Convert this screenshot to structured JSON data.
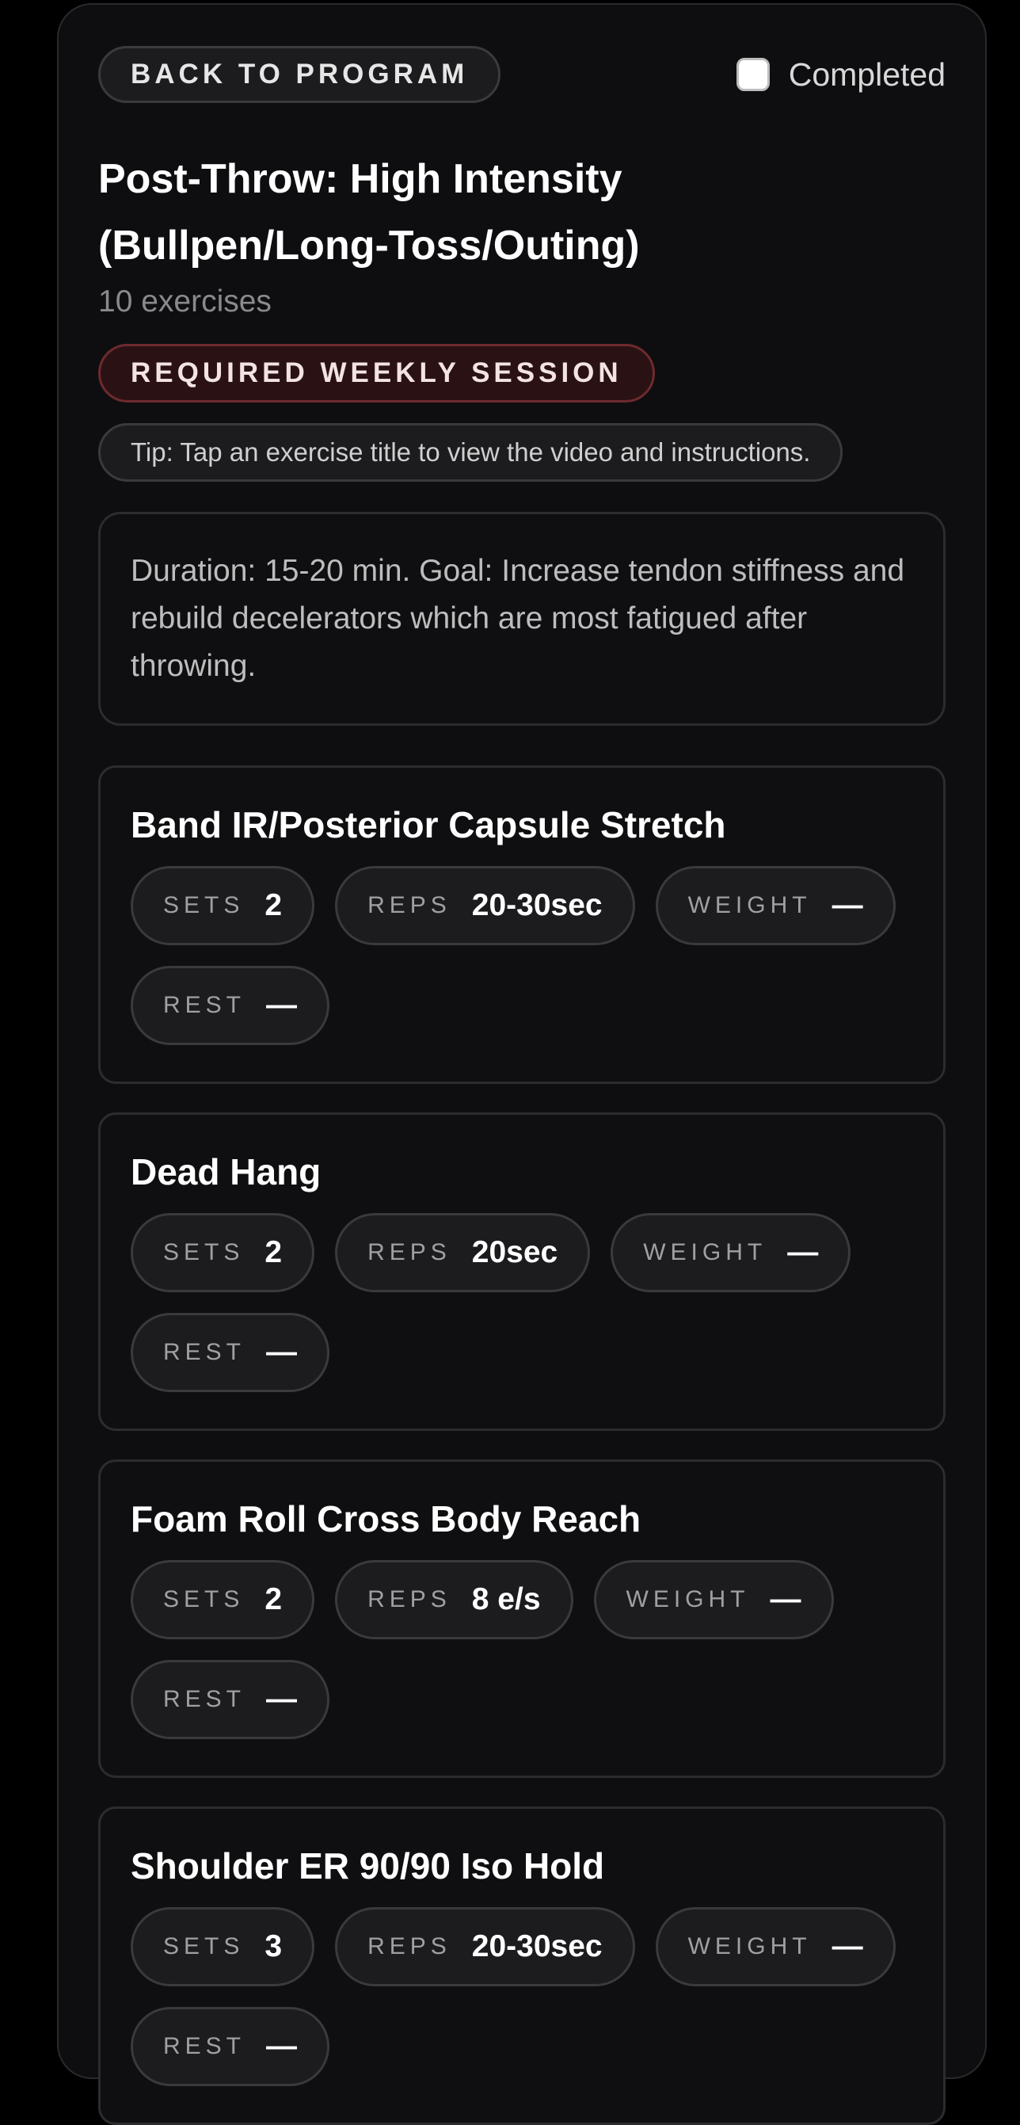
{
  "header": {
    "back_label": "BACK TO PROGRAM",
    "completed_label": "Completed",
    "completed_checked": false
  },
  "session": {
    "title": "Post-Throw: High Intensity (Bullpen/Long-Toss/Outing)",
    "count": "10 exercises",
    "badge": "REQUIRED WEEKLY SESSION",
    "tip": "Tip: Tap an exercise title to view the video and instructions.",
    "description": "Duration: 15-20 min. Goal: Increase tendon stiffness and rebuild decelerators which are most fatigued after throwing."
  },
  "labels": {
    "sets": "SETS",
    "reps": "REPS",
    "weight": "WEIGHT",
    "rest": "REST"
  },
  "exercises": [
    {
      "name": "Band IR/Posterior Capsule Stretch",
      "sets": "2",
      "reps": "20-30sec",
      "weight": "—",
      "rest": "—"
    },
    {
      "name": "Dead Hang",
      "sets": "2",
      "reps": "20sec",
      "weight": "—",
      "rest": "—"
    },
    {
      "name": "Foam Roll Cross Body Reach",
      "sets": "2",
      "reps": "8 e/s",
      "weight": "—",
      "rest": "—"
    },
    {
      "name": "Shoulder ER 90/90 Iso Hold",
      "sets": "3",
      "reps": "20-30sec",
      "weight": "—",
      "rest": "—"
    }
  ],
  "colors": {
    "background": "#000000",
    "panel": "#0e0e10",
    "badge_border": "#6e2a2e",
    "badge_bg": "#2a1214"
  }
}
